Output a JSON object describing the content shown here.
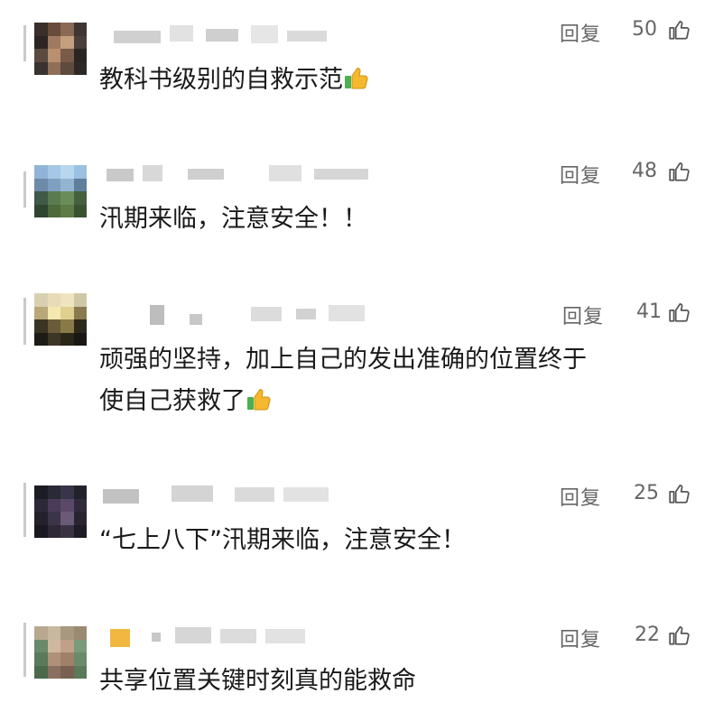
{
  "comments": [
    {
      "text": "教科书级别的自救示范",
      "emoji": "thumbs-up-icon",
      "reply_label": "回复",
      "likes": "50"
    },
    {
      "text": "汛期来临，注意安全！！",
      "emoji": "",
      "reply_label": "回复",
      "likes": "48"
    },
    {
      "text_line1": "顽强的坚持，加上自己的发出准确的位置终于",
      "text_line2": "使自己获救了",
      "emoji": "thumbs-up-icon",
      "reply_label": "回复",
      "likes": "41"
    },
    {
      "text": "“七上八下”汛期来临，注意安全！",
      "emoji": "",
      "reply_label": "回复",
      "likes": "25"
    },
    {
      "text": "共享位置关键时刻真的能救命",
      "emoji": "",
      "reply_label": "回复",
      "likes": "22"
    }
  ],
  "colors": {
    "meta_text": "#666666",
    "body_text": "#1a1a1a",
    "emoji_yellow": "#f5b82e",
    "emoji_green": "#4caf50"
  }
}
